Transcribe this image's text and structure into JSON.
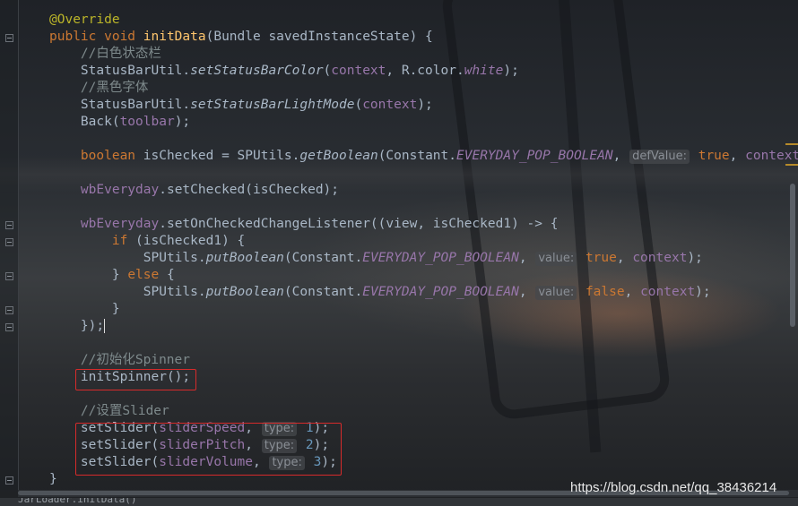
{
  "editor": {
    "lines": [
      [
        {
          "t": "@Override",
          "c": "ann"
        }
      ],
      [
        {
          "t": "public void ",
          "c": "kw"
        },
        {
          "t": "initData",
          "c": "fn"
        },
        {
          "t": "(Bundle savedInstanceState) {"
        }
      ],
      [
        {
          "t": "    "
        },
        {
          "t": "//白色状态栏",
          "c": "cm"
        }
      ],
      [
        {
          "t": "    StatusBarUtil."
        },
        {
          "t": "setStatusBarColor",
          "c": "stat"
        },
        {
          "t": "("
        },
        {
          "t": "context",
          "c": "par"
        },
        {
          "t": ", R.color."
        },
        {
          "t": "white",
          "c": "cst"
        },
        {
          "t": ");"
        }
      ],
      [
        {
          "t": "    "
        },
        {
          "t": "//黑色字体",
          "c": "cm"
        }
      ],
      [
        {
          "t": "    StatusBarUtil."
        },
        {
          "t": "setStatusBarLightMode",
          "c": "stat"
        },
        {
          "t": "("
        },
        {
          "t": "context",
          "c": "par"
        },
        {
          "t": ");"
        }
      ],
      [
        {
          "t": "    Back("
        },
        {
          "t": "toolbar",
          "c": "par"
        },
        {
          "t": ");"
        }
      ],
      [],
      [
        {
          "t": "    "
        },
        {
          "t": "boolean ",
          "c": "kw"
        },
        {
          "t": "isChecked = SPUtils."
        },
        {
          "t": "getBoolean",
          "c": "stat"
        },
        {
          "t": "(Constant."
        },
        {
          "t": "EVERYDAY_POP_BOOLEAN",
          "c": "cst"
        },
        {
          "t": ", "
        },
        {
          "t": "defValue:",
          "c": "hint"
        },
        {
          "t": " "
        },
        {
          "t": "true",
          "c": "kw"
        },
        {
          "t": ", "
        },
        {
          "t": "context",
          "c": "par"
        },
        {
          "t": ");"
        }
      ],
      [],
      [
        {
          "t": "    "
        },
        {
          "t": "wbEveryday",
          "c": "par"
        },
        {
          "t": ".setChecked(isChecked);"
        }
      ],
      [],
      [
        {
          "t": "    "
        },
        {
          "t": "wbEveryday",
          "c": "par"
        },
        {
          "t": ".setOnCheckedChangeListener((view, isChecked1) -> {"
        }
      ],
      [
        {
          "t": "        "
        },
        {
          "t": "if ",
          "c": "kw"
        },
        {
          "t": "(isChecked1) {"
        }
      ],
      [
        {
          "t": "            SPUtils."
        },
        {
          "t": "putBoolean",
          "c": "stat"
        },
        {
          "t": "(Constant."
        },
        {
          "t": "EVERYDAY_POP_BOOLEAN",
          "c": "cst"
        },
        {
          "t": ", "
        },
        {
          "t": "value:",
          "c": "hint"
        },
        {
          "t": " "
        },
        {
          "t": "true",
          "c": "kw"
        },
        {
          "t": ", "
        },
        {
          "t": "context",
          "c": "par"
        },
        {
          "t": ");"
        }
      ],
      [
        {
          "t": "        } "
        },
        {
          "t": "else ",
          "c": "kw"
        },
        {
          "t": "{"
        }
      ],
      [
        {
          "t": "            SPUtils."
        },
        {
          "t": "putBoolean",
          "c": "stat"
        },
        {
          "t": "(Constant."
        },
        {
          "t": "EVERYDAY_POP_BOOLEAN",
          "c": "cst"
        },
        {
          "t": ", "
        },
        {
          "t": "value:",
          "c": "hint"
        },
        {
          "t": " "
        },
        {
          "t": "false",
          "c": "kw"
        },
        {
          "t": ", "
        },
        {
          "t": "context",
          "c": "par"
        },
        {
          "t": ");"
        }
      ],
      [
        {
          "t": "        }"
        }
      ],
      [
        {
          "t": "    });"
        },
        {
          "t": "",
          "c": "caret"
        }
      ],
      [],
      [
        {
          "t": "    "
        },
        {
          "t": "//初始化Spinner",
          "c": "cm"
        }
      ],
      [
        {
          "t": "    initSpinner();"
        }
      ],
      [],
      [
        {
          "t": "    "
        },
        {
          "t": "//设置Slider",
          "c": "cm"
        }
      ],
      [
        {
          "t": "    setSlider("
        },
        {
          "t": "sliderSpeed",
          "c": "par"
        },
        {
          "t": ", "
        },
        {
          "t": "type:",
          "c": "hint"
        },
        {
          "t": " "
        },
        {
          "t": "1",
          "c": "num"
        },
        {
          "t": ");"
        }
      ],
      [
        {
          "t": "    setSlider("
        },
        {
          "t": "sliderPitch",
          "c": "par"
        },
        {
          "t": ", "
        },
        {
          "t": "type:",
          "c": "hint"
        },
        {
          "t": " "
        },
        {
          "t": "2",
          "c": "num"
        },
        {
          "t": ");"
        }
      ],
      [
        {
          "t": "    setSlider("
        },
        {
          "t": "sliderVolume",
          "c": "par"
        },
        {
          "t": ", "
        },
        {
          "t": "type:",
          "c": "hint"
        },
        {
          "t": " "
        },
        {
          "t": "3",
          "c": "num"
        },
        {
          "t": ");"
        }
      ],
      [
        {
          "t": "}"
        }
      ]
    ],
    "highlighted_lines": [
      [
        21,
        21
      ],
      [
        24,
        26
      ]
    ]
  },
  "colors": {
    "annotation": "#bbb529",
    "keyword": "#cc7832",
    "method_declaration": "#ffc66d",
    "comment": "#7e8a8c",
    "field": "#9876aa",
    "number": "#6897bb",
    "default_text": "#a9b7c6",
    "highlight_box": "#d62b2b"
  },
  "status_bar": {
    "text": "JarLoader.initData()"
  },
  "watermark": {
    "text": "https://blog.csdn.net/qq_38436214"
  }
}
